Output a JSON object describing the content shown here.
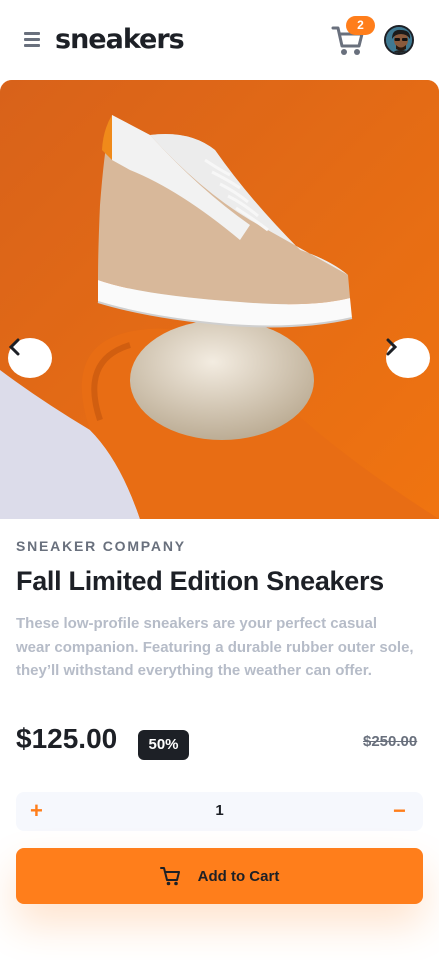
{
  "header": {
    "logo": "sneakers",
    "cart_count": "2",
    "menu_icon": "hamburger-icon",
    "cart_icon": "cart-icon"
  },
  "gallery": {
    "prev_icon": "chevron-left-icon",
    "next_icon": "chevron-right-icon"
  },
  "product": {
    "company": "SNEAKER COMPANY",
    "title": "Fall Limited Edition Sneakers",
    "description": "These low-profile sneakers are your perfect casual wear companion. Featuring a durable rubber outer sole, they’ll withstand everything the weather can offer.",
    "price": "$125.00",
    "discount": "50%",
    "original_price": "$250.00"
  },
  "quantity": {
    "plus": "+",
    "value": "1",
    "minus": "−"
  },
  "cta": {
    "add_to_cart": "Add to Cart"
  },
  "colors": {
    "accent": "#ff7e1b",
    "dark": "#1d2026",
    "muted": "#69707d",
    "light_text": "#b6bcc8",
    "qty_bg": "#f6f8fd"
  }
}
